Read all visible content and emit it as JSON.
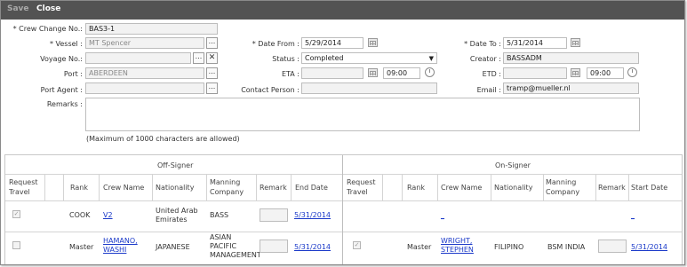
{
  "toolbar": {
    "save_label": "Save",
    "close_label": "Close"
  },
  "form": {
    "crew_change_no": {
      "label": "Crew Change No.:",
      "value": "BAS3-1"
    },
    "vessel": {
      "label": "Vessel :",
      "value": "MT Spencer",
      "lookup": "..."
    },
    "voyage_no": {
      "label": "Voyage No.:",
      "value": "",
      "lookup": "...",
      "clear": "✕"
    },
    "port": {
      "label": "Port :",
      "value": "ABERDEEN",
      "lookup": "..."
    },
    "port_agent": {
      "label": "Port Agent :",
      "value": "",
      "lookup": "..."
    },
    "remarks": {
      "label": "Remarks :",
      "value": "",
      "note": "(Maximum of 1000 characters are allowed)"
    },
    "date_from": {
      "label": "Date From :",
      "value": "5/29/2014"
    },
    "status": {
      "label": "Status :",
      "value": "Completed"
    },
    "eta": {
      "label": "ETA :",
      "date": "",
      "time": "09:00"
    },
    "contact_person": {
      "label": "Contact Person :",
      "value": ""
    },
    "date_to": {
      "label": "Date To :",
      "value": "5/31/2014"
    },
    "creator": {
      "label": "Creator :",
      "value": "BASSADM"
    },
    "etd": {
      "label": "ETD :",
      "date": "",
      "time": "09:00"
    },
    "email": {
      "label": "Email :",
      "value": "tramp@mueller.nl"
    },
    "required_mark": "*"
  },
  "grid": {
    "off_signer_title": "Off-Signer",
    "on_signer_title": "On-Signer",
    "columns": {
      "request_travel": "Request Travel",
      "rank": "Rank",
      "crew_name": "Crew Name",
      "nationality": "Nationality",
      "manning_company": "Manning Company",
      "remark": "Remark",
      "end_date": "End Date",
      "start_date": "Start Date"
    },
    "rows": [
      {
        "off": {
          "checked": "✓",
          "rank": "COOK",
          "crew_name": "V2",
          "nationality": "United Arab Emirates",
          "manning": "BASS",
          "end_date": "5/31/2014"
        },
        "on": {
          "checked": "",
          "rank": "",
          "crew_name": "_",
          "nationality": "",
          "manning": "",
          "start_date": "_"
        }
      },
      {
        "off": {
          "checked": "",
          "rank": "Master",
          "crew_name": "HAMANO, WASHI",
          "nationality": "JAPANESE",
          "manning": "ASIAN PACIFIC MANAGEMENT",
          "end_date": "5/31/2014"
        },
        "on": {
          "checked": "✓",
          "rank": "Master",
          "crew_name": "WRIGHT, STEPHEN",
          "nationality": "FILIPINO",
          "manning": "BSM INDIA",
          "start_date": "5/31/2014"
        }
      }
    ]
  },
  "icons": {
    "calendar": "calendar-icon",
    "clock": "clock-icon",
    "ellipsis": "ellipsis-icon",
    "dropdown": "dropdown-arrow-icon"
  },
  "colors": {
    "toolbar_bg": "#535353",
    "link": "#1a39c9"
  }
}
